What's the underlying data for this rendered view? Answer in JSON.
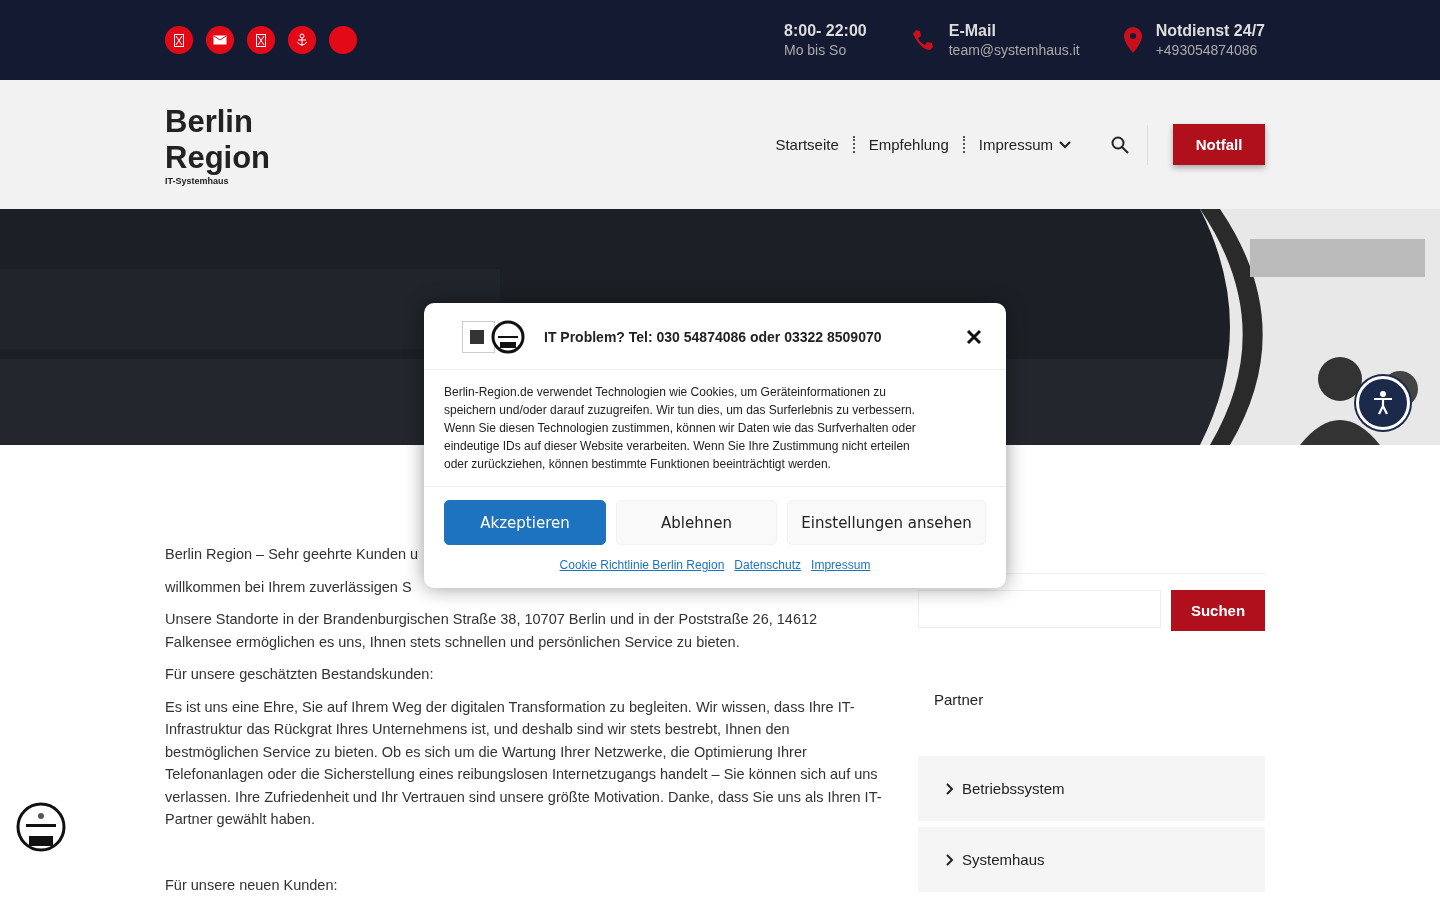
{
  "topbar": {
    "info": [
      {
        "kind": "none",
        "title": "8:00- 22:00",
        "subtitle": "Mo bis So"
      },
      {
        "kind": "phone",
        "title": "E-Mail",
        "subtitle": "team@systemhaus.it"
      },
      {
        "kind": "pin",
        "title": "Notdienst 24/7",
        "subtitle": "+493054874086"
      }
    ]
  },
  "header": {
    "logo": "Berlin Region",
    "tagline": "IT-Systemhaus",
    "nav": [
      {
        "label": "Startseite",
        "dropdown": false
      },
      {
        "label": "Empfehlung",
        "dropdown": false
      },
      {
        "label": "Impressum",
        "dropdown": true
      }
    ],
    "cta": "Notfall"
  },
  "content": {
    "paragraphs": [
      {
        "kind": "cut",
        "text": "Berlin Region – Sehr geehrte Kunden u"
      },
      {
        "kind": "cut",
        "text": "willkommen bei Ihrem zuverlässigen S"
      },
      {
        "kind": "tight",
        "text": "Unsere Standorte in der Brandenburgischen Straße 38, 10707 Berlin und in der Poststraße 26, 14612 Falkensee ermöglichen es uns, Ihnen stets schnellen und persönlichen Service zu bieten."
      },
      {
        "kind": "normal",
        "text": "Für unsere geschätzten Bestandskunden:"
      },
      {
        "kind": "normal",
        "text": "Es ist uns eine Ehre, Sie auf Ihrem Weg der digitalen Transformation zu begleiten. Wir wissen, dass Ihre IT-Infrastruktur das Rückgrat Ihres Unternehmens ist, und deshalb sind wir stets bestrebt, Ihnen den bestmöglichen Service zu bieten. Ob es sich um die Wartung Ihrer Netzwerke, die Optimierung Ihrer Telefonanlagen oder die Sicherstellung eines reibungslosen Internetzugangs handelt – Sie können sich auf uns verlassen. Ihre Zufriedenheit und Ihr Vertrauen sind unsere größte Motivation. Danke, dass Sie uns als Ihren IT-Partner gewählt haben."
      },
      {
        "kind": "spaced",
        "text": "Für unsere neuen Kunden:"
      }
    ]
  },
  "sidebar": {
    "search_button": "Suchen",
    "heading": "Partner",
    "accordion": [
      {
        "label": "Betriebssystem",
        "expanded": false
      },
      {
        "label": "Systemhaus",
        "expanded": false
      }
    ]
  },
  "cookie_dialog": {
    "title": "IT Problem? Tel: 030 54874086 oder 03322 8509070",
    "text": "Berlin-Region.de verwendet Technologien wie Cookies, um Geräteinformationen zu speichern und/oder darauf zuzugreifen. Wir tun dies, um das Surferlebnis zu verbessern. Wenn Sie diesen Technologien zustimmen, können wir Daten wie das Surfverhalten oder eindeutige IDs auf dieser Website verarbeiten. Wenn Sie Ihre Zustimmung nicht erteilen oder zurückziehen, können bestimmte Funktionen beeinträchtigt werden.",
    "buttons": [
      {
        "label": "Akzeptieren",
        "kind": "primary"
      },
      {
        "label": "Ablehnen",
        "kind": "secondary"
      },
      {
        "label": "Einstellungen ansehen",
        "kind": "secondary"
      }
    ],
    "links": [
      "Cookie Richtlinie Berlin Region",
      "Datenschutz",
      "Impressum"
    ]
  }
}
